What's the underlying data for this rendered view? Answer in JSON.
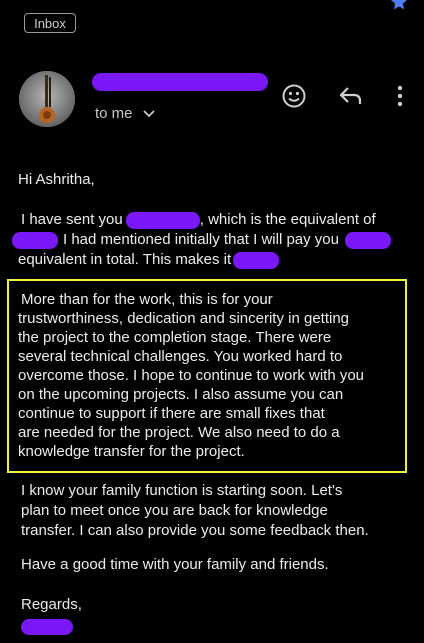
{
  "header": {
    "inbox_label": "Inbox",
    "to_label": "to me"
  },
  "icons": {
    "star": "star-icon",
    "emoji": "emoji-icon",
    "reply": "reply-icon",
    "more": "more-vertical-icon",
    "chevron": "chevron-down-icon"
  },
  "colors": {
    "background": "#000000",
    "redaction": "#7b18f7",
    "highlight_border": "#f2f230",
    "star": "#4f7bf5"
  },
  "body": {
    "greeting": "Hi Ashritha,",
    "p1": {
      "l1a": "I have sent you",
      "l1b": ", which is the equivalent of",
      "l2": "I had mentioned initially that I will pay you",
      "l3": "equivalent in total. This makes it"
    },
    "p2": {
      "lines": [
        "More than for the work, this is for your",
        "trustworthiness, dedication and sincerity in getting",
        "the project to the completion stage. There were",
        "several technical challenges. You worked hard to",
        "overcome those. I hope to continue to work with you",
        "on the upcoming projects. I also assume you can",
        "continue to support if there are small fixes that",
        "are needed for the project. We also need to do a",
        "knowledge transfer for the project."
      ]
    },
    "p3": {
      "lines": [
        "I know your family function is starting soon. Let's",
        "plan to meet once you are back for knowledge",
        "transfer. I can also provide you some feedback then."
      ]
    },
    "p4": "Have a good time with your family and friends.",
    "signoff": "Regards,"
  }
}
